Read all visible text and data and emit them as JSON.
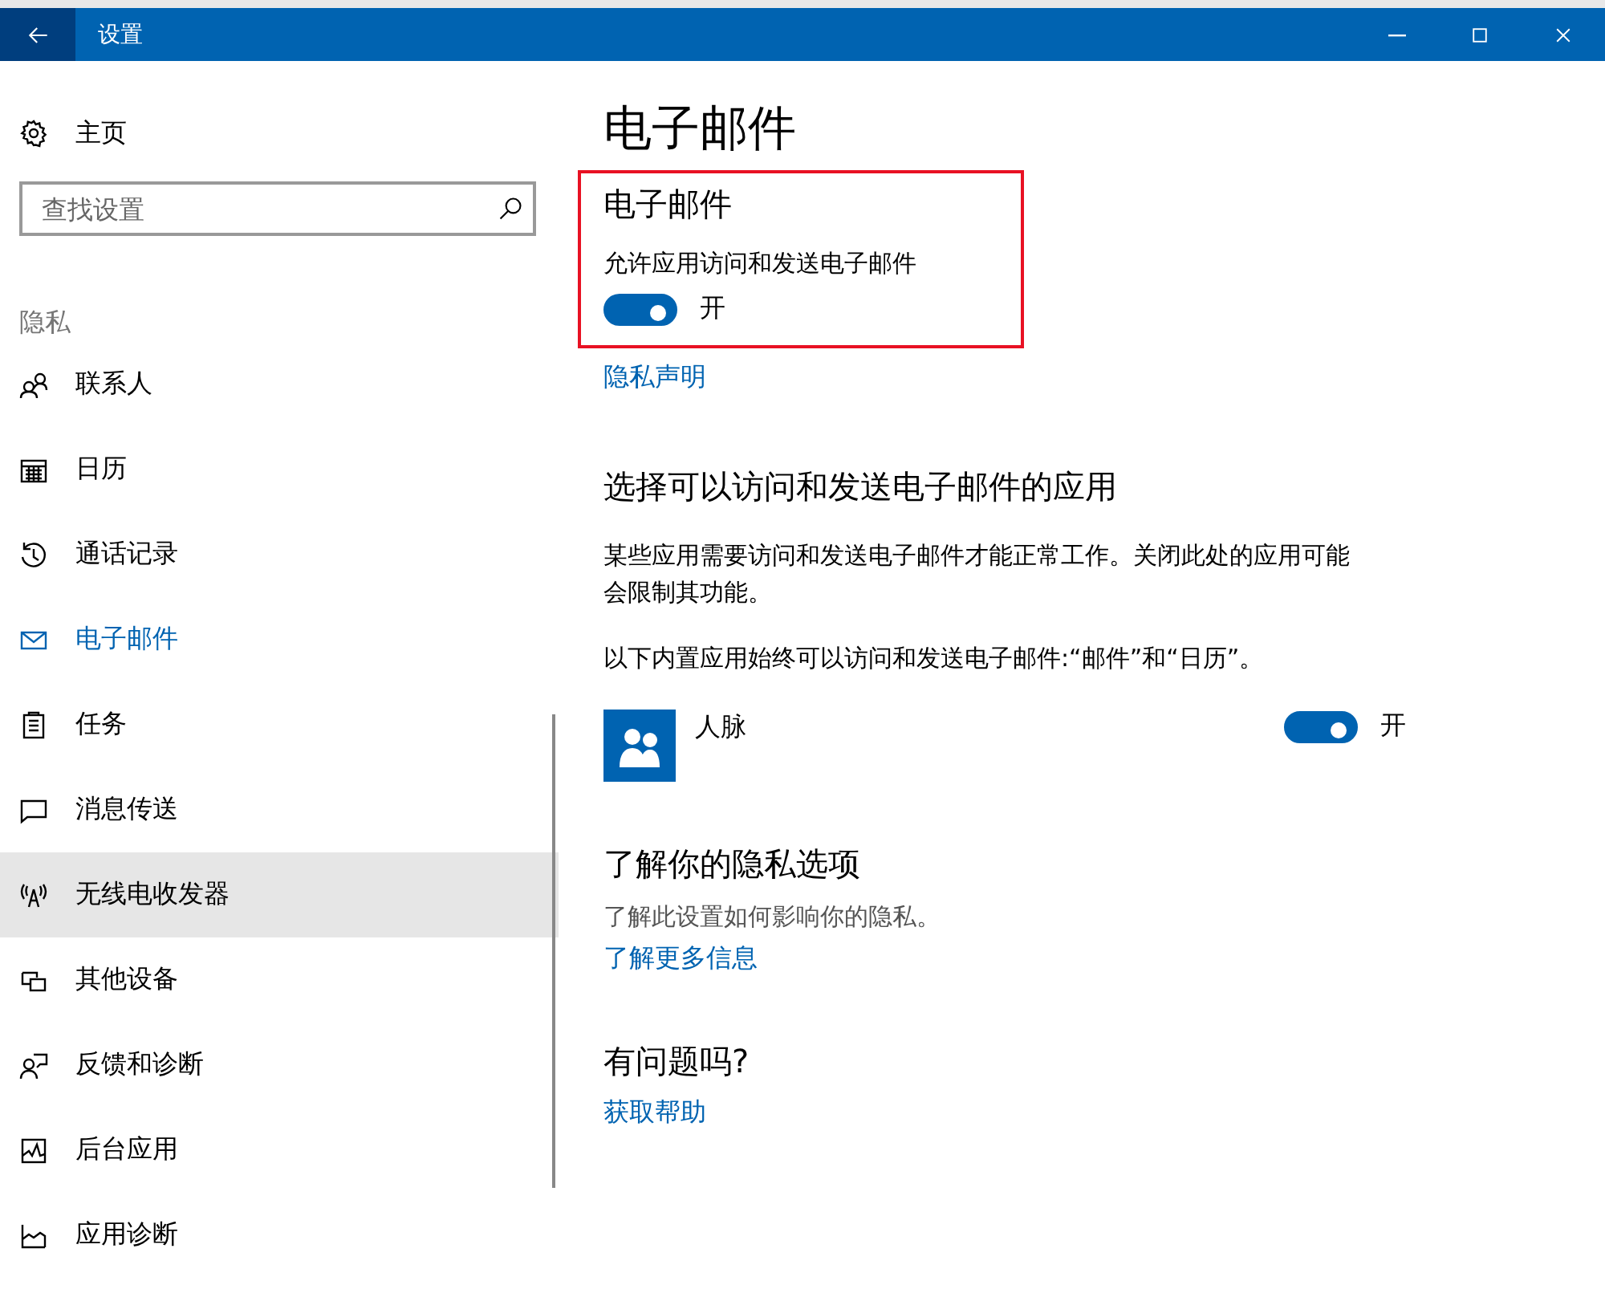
{
  "window": {
    "title": "设置"
  },
  "sidebar": {
    "home": "主页",
    "search": {
      "placeholder": "查找设置"
    },
    "section": "隐私",
    "items": [
      {
        "label": "联系人",
        "selected": false,
        "hovered": false
      },
      {
        "label": "日历",
        "selected": false,
        "hovered": false
      },
      {
        "label": "通话记录",
        "selected": false,
        "hovered": false
      },
      {
        "label": "电子邮件",
        "selected": true,
        "hovered": false
      },
      {
        "label": "任务",
        "selected": false,
        "hovered": false
      },
      {
        "label": "消息传送",
        "selected": false,
        "hovered": false
      },
      {
        "label": "无线电收发器",
        "selected": false,
        "hovered": true
      },
      {
        "label": "其他设备",
        "selected": false,
        "hovered": false
      },
      {
        "label": "反馈和诊断",
        "selected": false,
        "hovered": false
      },
      {
        "label": "后台应用",
        "selected": false,
        "hovered": false
      },
      {
        "label": "应用诊断",
        "selected": false,
        "hovered": false
      }
    ]
  },
  "main": {
    "title": "电子邮件",
    "highlight_section": {
      "heading": "电子邮件",
      "setting_label": "允许应用访问和发送电子邮件",
      "toggle": {
        "on": true,
        "state_text": "开"
      }
    },
    "privacy_link": "隐私声明",
    "apps_section": {
      "heading": "选择可以访问和发送电子邮件的应用",
      "description": "某些应用需要访问和发送电子邮件才能正常工作。关闭此处的应用可能会限制其功能。",
      "note": "以下内置应用始终可以访问和发送电子邮件:“邮件”和“日历”。",
      "apps": [
        {
          "name": "人脉",
          "on": true,
          "state_text": "开"
        }
      ]
    },
    "privacy_options": {
      "heading": "了解你的隐私选项",
      "text": "了解此设置如何影响你的隐私。",
      "link": "了解更多信息"
    },
    "help": {
      "heading": "有问题吗?",
      "link": "获取帮助"
    }
  }
}
